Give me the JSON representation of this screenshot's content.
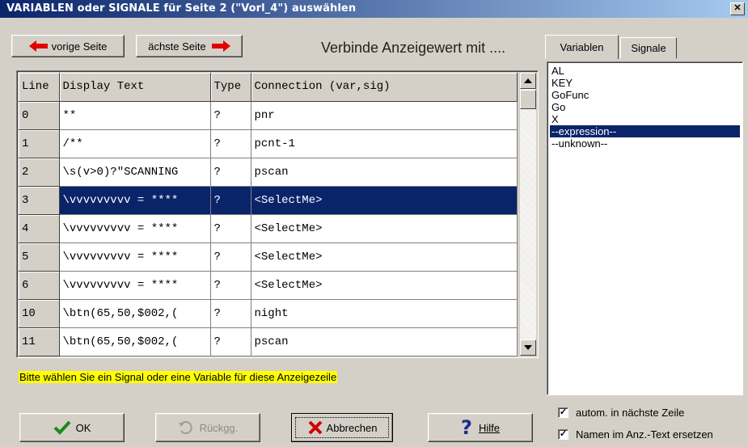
{
  "window": {
    "title": "VARIABLEN oder SIGNALE für Seite 2 (\"Vorl_4\") auswählen",
    "close_glyph": "✕"
  },
  "nav": {
    "prev_label": "vorige Seite",
    "next_label": "ächste Seite"
  },
  "heading": "Verbinde Anzeigewert mit ....",
  "tabs": [
    {
      "label": "Variablen",
      "active": true
    },
    {
      "label": "Signale",
      "active": false
    }
  ],
  "grid": {
    "columns": [
      "Line",
      "Display Text",
      "Type",
      "Connection (var,sig)"
    ],
    "rows": [
      {
        "line": "0",
        "text": "**",
        "type": "?",
        "conn": "pnr",
        "selected": false
      },
      {
        "line": "1",
        "text": "/**",
        "type": "?",
        "conn": "pcnt-1",
        "selected": false
      },
      {
        "line": "2",
        "text": "\\s(v>0)?\"SCANNING",
        "type": "?",
        "conn": "pscan",
        "selected": false
      },
      {
        "line": "3",
        "text": "\\vvvvvvvvv = ****",
        "type": "?",
        "conn": "<SelectMe>",
        "selected": true
      },
      {
        "line": "4",
        "text": "\\vvvvvvvvv = ****",
        "type": "?",
        "conn": "<SelectMe>",
        "selected": false
      },
      {
        "line": "5",
        "text": "\\vvvvvvvvv = ****",
        "type": "?",
        "conn": "<SelectMe>",
        "selected": false
      },
      {
        "line": "6",
        "text": "\\vvvvvvvvv = ****",
        "type": "?",
        "conn": "<SelectMe>",
        "selected": false
      },
      {
        "line": "10",
        "text": "\\btn(65,50,$002,(",
        "type": "?",
        "conn": "night",
        "selected": false
      },
      {
        "line": "11",
        "text": "\\btn(65,50,$002,(",
        "type": "?",
        "conn": "pscan",
        "selected": false
      }
    ]
  },
  "hint": "Bitte wählen Sie ein Signal oder eine Variable für diese Anzeigezeile",
  "list": {
    "items": [
      "AL",
      "KEY",
      "GoFunc",
      "Go",
      "X",
      "--expression--",
      "--unknown--"
    ],
    "selected_index": 5
  },
  "checkboxes": [
    {
      "label": "autom. in nächste Zeile",
      "checked": true
    },
    {
      "label": "Namen im Anz.-Text ersetzen",
      "checked": true
    }
  ],
  "buttons": {
    "ok": "OK",
    "undo": "Rückgg.",
    "cancel": "Abbrechen",
    "help": "Hilfe"
  },
  "colors": {
    "selection": "#0a246a",
    "hint_bg": "#ffff00",
    "face": "#d4d0c8"
  }
}
